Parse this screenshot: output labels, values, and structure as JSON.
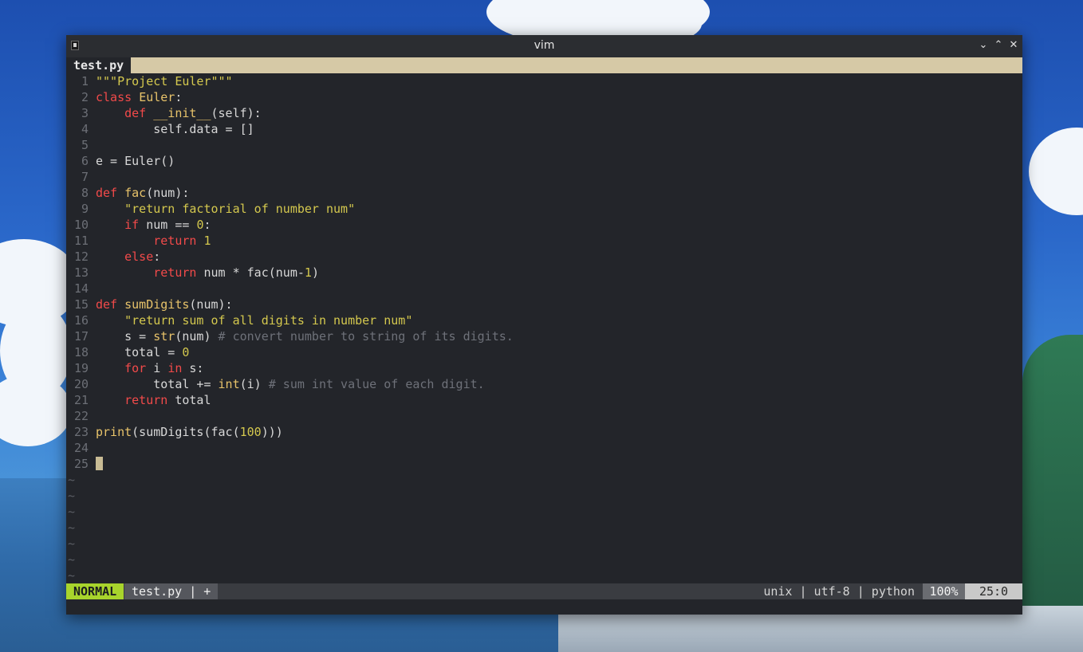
{
  "window": {
    "title": "vim"
  },
  "tabline": {
    "active_tab": "test.py"
  },
  "colors": {
    "keyword": "#f24a4a",
    "function": "#e8c36a",
    "string": "#d4c84e",
    "comment": "#6e7179",
    "mode_bg": "#a8d42c",
    "tab_fill": "#d6c9a6"
  },
  "editor": {
    "lines": [
      {
        "n": "1"
      },
      {
        "n": "2"
      },
      {
        "n": "3"
      },
      {
        "n": "4"
      },
      {
        "n": "5"
      },
      {
        "n": "6"
      },
      {
        "n": "7"
      },
      {
        "n": "8"
      },
      {
        "n": "9"
      },
      {
        "n": "10"
      },
      {
        "n": "11"
      },
      {
        "n": "12"
      },
      {
        "n": "13"
      },
      {
        "n": "14"
      },
      {
        "n": "15"
      },
      {
        "n": "16"
      },
      {
        "n": "17"
      },
      {
        "n": "18"
      },
      {
        "n": "19"
      },
      {
        "n": "20"
      },
      {
        "n": "21"
      },
      {
        "n": "22"
      },
      {
        "n": "23"
      },
      {
        "n": "24"
      },
      {
        "n": "25"
      }
    ],
    "code": {
      "l1": "\"\"\"Project Euler\"\"\"",
      "l2_kw": "class",
      "l2_name": "Euler",
      "l2_rest": ":",
      "l3_kw": "def",
      "l3_name": "__init__",
      "l3_rest": "(self):",
      "l4": "self.data = []",
      "l6": "e = Euler()",
      "l8_kw": "def",
      "l8_name": "fac",
      "l8_rest": "(num):",
      "l9": "\"return factorial of number num\"",
      "l10_kw": "if",
      "l10_mid": " num == ",
      "l10_num": "0",
      "l10_rest": ":",
      "l11_kw": "return",
      "l11_num": "1",
      "l12_kw": "else",
      "l12_rest": ":",
      "l13_kw": "return",
      "l13_mid": " num * fac(num-",
      "l13_num": "1",
      "l13_rest": ")",
      "l15_kw": "def",
      "l15_name": "sumDigits",
      "l15_rest": "(num):",
      "l16": "\"return sum of all digits in number num\"",
      "l17_a": "s = ",
      "l17_bi": "str",
      "l17_b": "(num) ",
      "l17_cmt": "# convert number to string of its digits.",
      "l18_a": "total = ",
      "l18_num": "0",
      "l19_kw1": "for",
      "l19_mid": " i ",
      "l19_kw2": "in",
      "l19_rest": " s:",
      "l20_a": "total += ",
      "l20_bi": "int",
      "l20_b": "(i) ",
      "l20_cmt": "# sum int value of each digit.",
      "l21_kw": "return",
      "l21_rest": " total",
      "l23_bi": "print",
      "l23_a": "(sumDigits(fac(",
      "l23_num": "100",
      "l23_b": ")))"
    },
    "tilde": "~"
  },
  "statusline": {
    "mode": "NORMAL",
    "file": "test.py | +",
    "info": "unix | utf-8 | python",
    "percent": "100%",
    "position": "25:0"
  }
}
